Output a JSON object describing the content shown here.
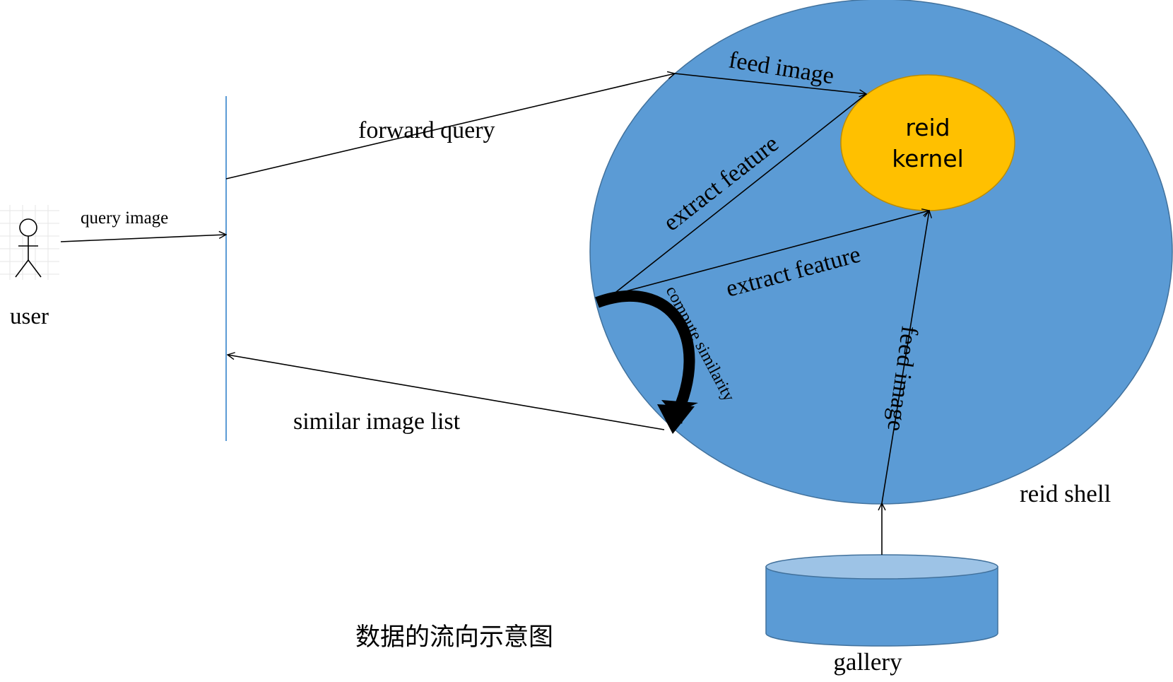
{
  "diagram": {
    "actor": {
      "label": "user",
      "icon": "stick-figure-icon"
    },
    "shell": {
      "label": "reid shell",
      "color": "#5b9bd5"
    },
    "kernel": {
      "label_line1": "reid",
      "label_line2": "kernel",
      "color": "#ffc000"
    },
    "gallery": {
      "label": "gallery",
      "color": "#5b9bd5"
    },
    "edges": {
      "query_image": "query image",
      "forward_query": "forward query",
      "feed_image_top": "feed image",
      "extract_feature_1": "extract feature",
      "extract_feature_2": "extract feature",
      "feed_image_gallery": "feed image",
      "compute_similarity": "compute similarity",
      "similar_image_list": "similar image list"
    },
    "caption": "数据的流向示意图"
  }
}
